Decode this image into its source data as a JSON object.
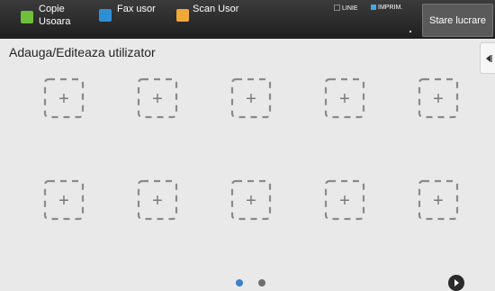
{
  "topbar": {
    "shortcuts": [
      {
        "label_line1": "Copie",
        "label_line2": "Usoara",
        "icon": "copy-icon"
      },
      {
        "label": "Fax usor",
        "icon": "fax-icon"
      },
      {
        "label": "Scan Usor",
        "icon": "scan-icon"
      }
    ],
    "status": {
      "line_label": "LINIE",
      "print_label": "IMPRIM."
    },
    "job_status_button": "Stare lucrare"
  },
  "main": {
    "title": "Adauga/Editeaza utilizator",
    "slot_glyph": "+",
    "slot_count": 10,
    "pager": {
      "pages": 2,
      "current": 1
    }
  },
  "colors": {
    "accent_blue": "#3c7fd0",
    "pager_inactive": "#6e6e6e",
    "slot_dash": "#8a8a8a"
  }
}
